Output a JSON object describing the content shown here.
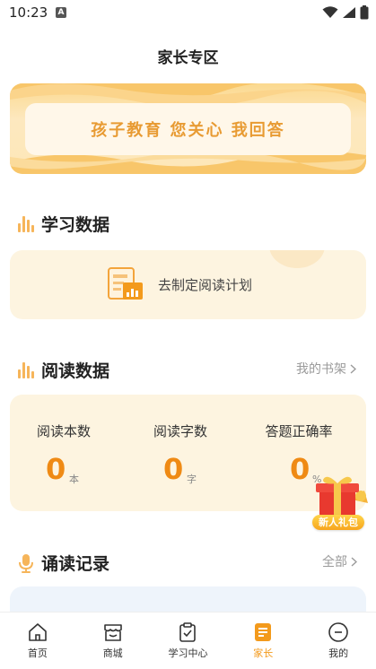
{
  "status_bar": {
    "time": "10:23",
    "notification_badge": "A"
  },
  "header": {
    "title": "家长专区"
  },
  "banner": {
    "slogan": "孩子教育 您关心 我回答"
  },
  "study_section": {
    "title": "学习数据",
    "plan_text": "去制定阅读计划"
  },
  "reading_section": {
    "title": "阅读数据",
    "more_label": "我的书架",
    "stats": [
      {
        "label": "阅读本数",
        "value": "0",
        "unit": "本"
      },
      {
        "label": "阅读字数",
        "value": "0",
        "unit": "字"
      },
      {
        "label": "答题正确率",
        "value": "0",
        "unit": "%"
      }
    ]
  },
  "gift": {
    "label": "新人礼包"
  },
  "recite_section": {
    "title": "诵读记录",
    "more_label": "全部"
  },
  "tab_bar": {
    "tabs": [
      {
        "label": "首页",
        "icon": "home-icon"
      },
      {
        "label": "商城",
        "icon": "store-icon"
      },
      {
        "label": "学习中心",
        "icon": "clipboard-check-icon"
      },
      {
        "label": "家长",
        "icon": "parent-doc-icon"
      },
      {
        "label": "我的",
        "icon": "profile-icon"
      }
    ],
    "active_index": 3
  },
  "colors": {
    "accent": "#f39a1c",
    "stat_value": "#ef8a14",
    "card_bg": "#fdf4e0",
    "banner_text": "#e89b33"
  }
}
